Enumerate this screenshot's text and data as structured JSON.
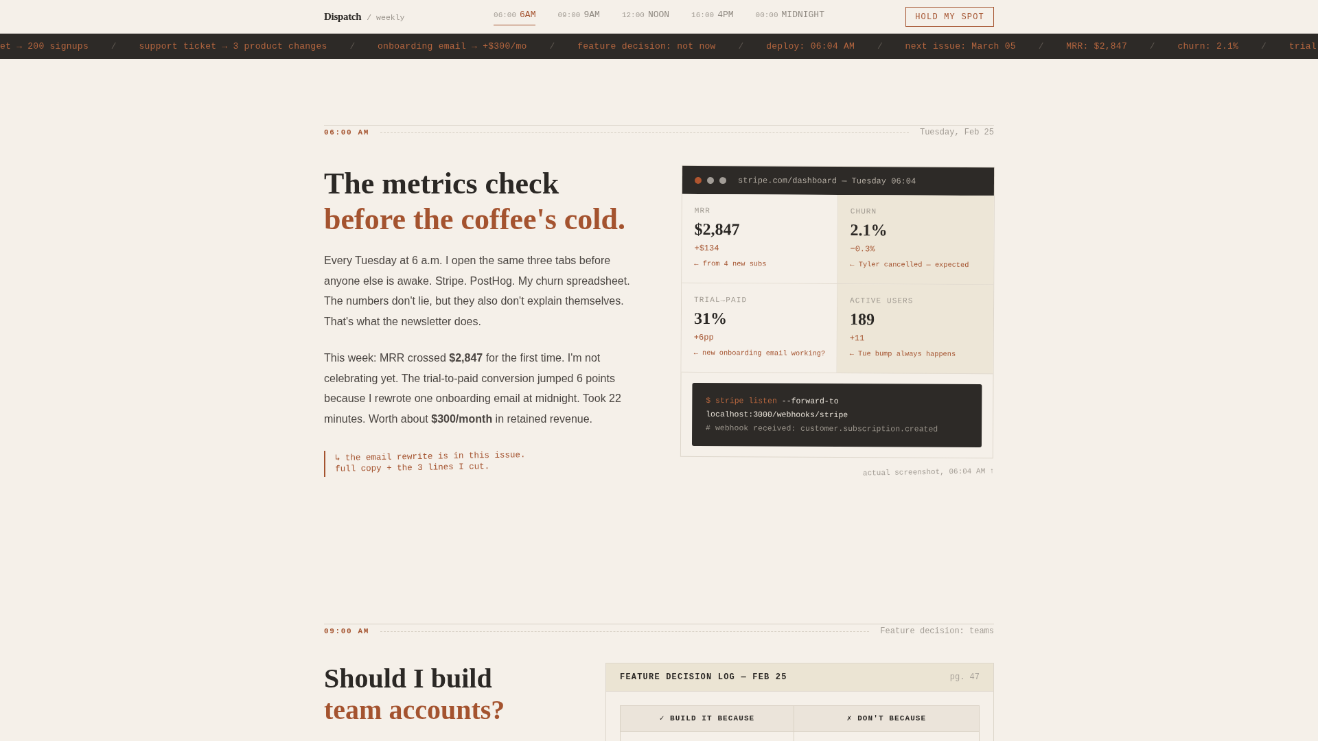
{
  "nav": {
    "brand": "Dispatch",
    "tagline": "/ weekly",
    "items": [
      {
        "time": "06:00",
        "label": "6AM",
        "selected": true
      },
      {
        "time": "09:00",
        "label": "9AM",
        "selected": false
      },
      {
        "time": "12:00",
        "label": "NOON",
        "selected": false
      },
      {
        "time": "16:00",
        "label": "4PM",
        "selected": false
      },
      {
        "time": "00:00",
        "label": "MIDNIGHT",
        "selected": false
      }
    ],
    "button": "HOLD MY SPOT"
  },
  "ticker": [
    {
      "kind": "item",
      "text": "et → 200 signups"
    },
    {
      "kind": "separator",
      "text": "/"
    },
    {
      "kind": "item",
      "text": "support ticket → 3 product changes"
    },
    {
      "kind": "separator",
      "text": "/"
    },
    {
      "kind": "item",
      "text": "onboarding email → +$300/mo"
    },
    {
      "kind": "separator",
      "text": "/"
    },
    {
      "kind": "item",
      "text": "feature decision: not now"
    },
    {
      "kind": "separator",
      "text": "/"
    },
    {
      "kind": "item",
      "text": "deploy: 06:04 AM"
    },
    {
      "kind": "separator",
      "text": "/"
    },
    {
      "kind": "item",
      "text": "next issue: March 05"
    },
    {
      "kind": "separator",
      "text": "/"
    },
    {
      "kind": "item",
      "text": "MRR: $2,847"
    },
    {
      "kind": "separator",
      "text": "/"
    },
    {
      "kind": "item",
      "text": "churn: 2.1%"
    },
    {
      "kind": "separator",
      "text": "/"
    },
    {
      "kind": "item",
      "text": "trial"
    }
  ],
  "sections": [
    {
      "kind": "metrics",
      "time": "06:00 AM",
      "aside": "Tuesday, Feb 25",
      "heading": {
        "text": "The metrics check",
        "accent": "before the coffee's cold."
      },
      "paragraphs": [
        "Every Tuesday at 6 a.m. I open the same three tabs before anyone else is awake. Stripe. PostHog. My churn spreadsheet. The numbers don't lie, but they also don't explain themselves. That's what the newsletter does.",
        "This week: MRR crossed **$2,847** for the first time. I'm not celebrating yet. The trial-to-paid conversion jumped 6 points because I rewrote one onboarding email at midnight. Took 22 minutes. Worth about **$300/month** in retained revenue."
      ],
      "note": "↳ the email rewrite is in this issue.\nfull copy + the 3 lines I cut.",
      "screenshot": {
        "url": "stripe.com/dashboard — Tuesday 06:04",
        "metrics": [
          {
            "label": "MRR",
            "value": "$2,847",
            "delta": "+$134",
            "note": "← from 4 new subs",
            "highlighted": false
          },
          {
            "label": "CHURN",
            "value": "2.1%",
            "delta": "−0.3%",
            "note": "← Tyler cancelled — expected",
            "highlighted": true
          },
          {
            "label": "TRIAL→PAID",
            "value": "31%",
            "delta": "+6pp",
            "note": "← new onboarding email working?",
            "highlighted": false
          },
          {
            "label": "ACTIVE USERS",
            "value": "189",
            "delta": "+11",
            "note": "← Tue bump always happens",
            "highlighted": true
          }
        ],
        "code": [
          [
            {
              "kind": "command",
              "text": "$ stripe listen"
            },
            {
              "kind": "plain",
              "text": "--forward-to"
            }
          ],
          [
            {
              "kind": "plain",
              "text": "localhost:3000/webhooks/stripe"
            }
          ],
          [
            {
              "kind": "comment",
              "text": "# webhook received: customer.subscription.created"
            }
          ]
        ]
      },
      "caption": "actual screenshot, 06:04 AM ↑"
    },
    {
      "kind": "decision",
      "time": "09:00 AM",
      "aside": "Feature decision: teams",
      "heading": {
        "text": "Should I build",
        "accent": "team accounts?"
      },
      "log": {
        "title": "FEATURE DECISION LOG — FEB 25",
        "page": "pg. 47",
        "columns": [
          "✓ BUILD IT BECAUSE",
          "✗ DON'T BECAUSE"
        ]
      }
    }
  ]
}
